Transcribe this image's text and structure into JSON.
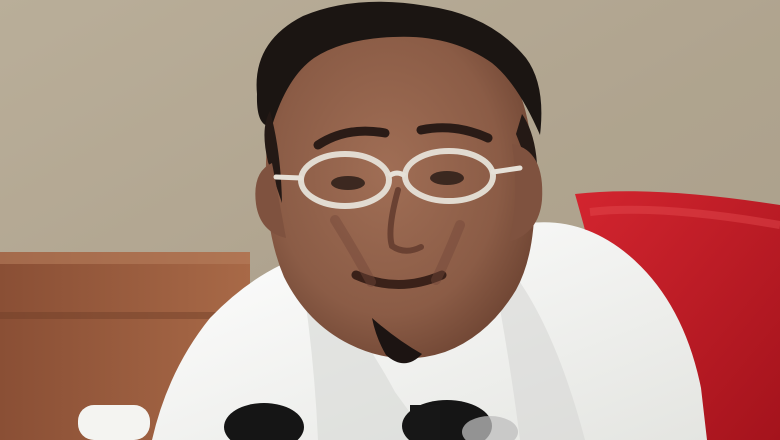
{
  "palette": {
    "wall": "#b8ab96",
    "wall_shadow": "#9d927f",
    "desk_wood": "#9a5a3c",
    "desk_wood_dark": "#6f3e28",
    "chair_red": "#c81a26",
    "chair_red_dark": "#8f0f18",
    "shirt_white": "#f2f2ef",
    "shirt_shadow": "#d8d9d6",
    "skin": "#8d5f49",
    "skin_shadow": "#6d4434",
    "hair": "#1b1512",
    "glasses": "#e6e1d8",
    "mic_black": "#151515"
  },
  "scene": {
    "objects": [
      "background-wall",
      "wooden-desk",
      "red-chair",
      "man",
      "white-shirt",
      "glasses",
      "microphones"
    ]
  }
}
